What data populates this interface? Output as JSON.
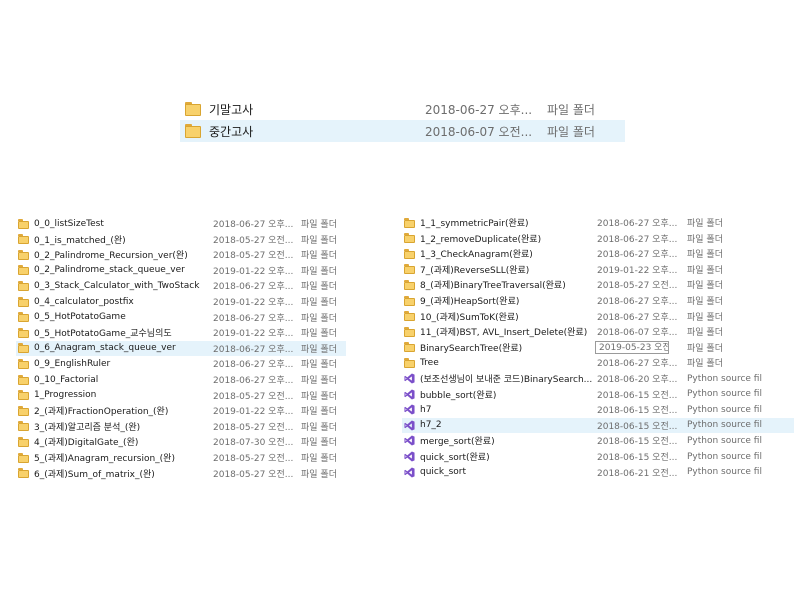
{
  "top_panel": {
    "items": [
      {
        "name": "기말고사",
        "date": "2018-06-27 오후...",
        "type": "파일 폴더",
        "selected": false
      },
      {
        "name": "중간고사",
        "date": "2018-06-07 오전...",
        "type": "파일 폴더",
        "selected": true
      }
    ]
  },
  "left_list": {
    "items": [
      {
        "name": "0_0_listSizeTest",
        "date": "2018-06-27 오후...",
        "type": "파일 폴더"
      },
      {
        "name": "0_1_is_matched_(완)",
        "date": "2018-05-27 오전...",
        "type": "파일 폴더"
      },
      {
        "name": "0_2_Palindrome_Recursion_ver(완)",
        "date": "2018-05-27 오전...",
        "type": "파일 폴더"
      },
      {
        "name": "0_2_Palindrome_stack_queue_ver",
        "date": "2019-01-22 오후...",
        "type": "파일 폴더"
      },
      {
        "name": "0_3_Stack_Calculator_with_TwoStack",
        "date": "2018-06-27 오후...",
        "type": "파일 폴더"
      },
      {
        "name": "0_4_calculator_postfix",
        "date": "2019-01-22 오후...",
        "type": "파일 폴더"
      },
      {
        "name": "0_5_HotPotatoGame",
        "date": "2018-06-27 오후...",
        "type": "파일 폴더"
      },
      {
        "name": "0_5_HotPotatoGame_교수님의도",
        "date": "2019-01-22 오후...",
        "type": "파일 폴더"
      },
      {
        "name": "0_6_Anagram_stack_queue_ver",
        "date": "2018-06-27 오후...",
        "type": "파일 폴더",
        "selected": true
      },
      {
        "name": "0_9_EnglishRuler",
        "date": "2018-06-27 오후...",
        "type": "파일 폴더"
      },
      {
        "name": "0_10_Factorial",
        "date": "2018-06-27 오후...",
        "type": "파일 폴더"
      },
      {
        "name": "1_Progression",
        "date": "2018-05-27 오전...",
        "type": "파일 폴더"
      },
      {
        "name": "2_(과제)FractionOperation_(완)",
        "date": "2019-01-22 오후...",
        "type": "파일 폴더"
      },
      {
        "name": "3_(과제)알고리즘 분석_(완)",
        "date": "2018-05-27 오전...",
        "type": "파일 폴더"
      },
      {
        "name": "4_(과제)DigitalGate_(완)",
        "date": "2018-07-30 오전...",
        "type": "파일 폴더"
      },
      {
        "name": "5_(과제)Anagram_recursion_(완)",
        "date": "2018-05-27 오전...",
        "type": "파일 폴더"
      },
      {
        "name": "6_(과제)Sum_of_matrix_(완)",
        "date": "2018-05-27 오전...",
        "type": "파일 폴더"
      }
    ]
  },
  "right_list": {
    "items": [
      {
        "name": "1_1_symmetricPair(완료)",
        "date": "2018-06-27 오후...",
        "type": "파일 폴더",
        "icon": "folder"
      },
      {
        "name": "1_2_removeDuplicate(완료)",
        "date": "2018-06-27 오후...",
        "type": "파일 폴더",
        "icon": "folder"
      },
      {
        "name": "1_3_CheckAnagram(완료)",
        "date": "2018-06-27 오후...",
        "type": "파일 폴더",
        "icon": "folder"
      },
      {
        "name": "7_(과제)ReverseSLL(완료)",
        "date": "2019-01-22 오후...",
        "type": "파일 폴더",
        "icon": "folder"
      },
      {
        "name": "8_(과제)BinaryTreeTraversal(완료)",
        "date": "2018-05-27 오전...",
        "type": "파일 폴더",
        "icon": "folder"
      },
      {
        "name": "9_(과제)HeapSort(완료)",
        "date": "2018-06-27 오후...",
        "type": "파일 폴더",
        "icon": "folder"
      },
      {
        "name": "10_(과제)SumToK(완료)",
        "date": "2018-06-27 오후...",
        "type": "파일 폴더",
        "icon": "folder"
      },
      {
        "name": "11_(과제)BST, AVL_Insert_Delete(완료)",
        "date": "2018-06-07 오후...",
        "type": "파일 폴더",
        "icon": "folder"
      },
      {
        "name": "BinarySearchTree(완료)",
        "date": "",
        "type": "파일 폴더",
        "icon": "folder",
        "editing": true
      },
      {
        "name": "Tree",
        "date": "2018-06-27 오후...",
        "type": "파일 폴더",
        "icon": "folder"
      },
      {
        "name": "(보조선생님이 보내준 코드)BinarySearch...",
        "date": "2018-06-20 오후...",
        "type": "Python source file",
        "icon": "python"
      },
      {
        "name": "bubble_sort(완료)",
        "date": "2018-06-15 오전...",
        "type": "Python source file",
        "icon": "python"
      },
      {
        "name": "h7",
        "date": "2018-06-15 오전...",
        "type": "Python source file",
        "icon": "python"
      },
      {
        "name": "h7_2",
        "date": "2018-06-15 오전...",
        "type": "Python source file",
        "icon": "python",
        "selected": true
      },
      {
        "name": "merge_sort(완료)",
        "date": "2018-06-15 오전...",
        "type": "Python source file",
        "icon": "python"
      },
      {
        "name": "quick_sort(완료)",
        "date": "2018-06-15 오전...",
        "type": "Python source file",
        "icon": "python"
      },
      {
        "name": "quick_sort",
        "date": "2018-06-21 오전...",
        "type": "Python source file",
        "icon": "python"
      }
    ],
    "edit_box_text": "2019-05-23 오전..."
  },
  "colors": {
    "folder_body": "#f8d16b",
    "folder_tab": "#e0a93a",
    "python_icon": "#7b4fc9",
    "selection": "#e5f3fb",
    "secondary_text": "#6d6d6d"
  },
  "icons": {
    "folder": "folder-icon",
    "python": "python-file-icon"
  }
}
